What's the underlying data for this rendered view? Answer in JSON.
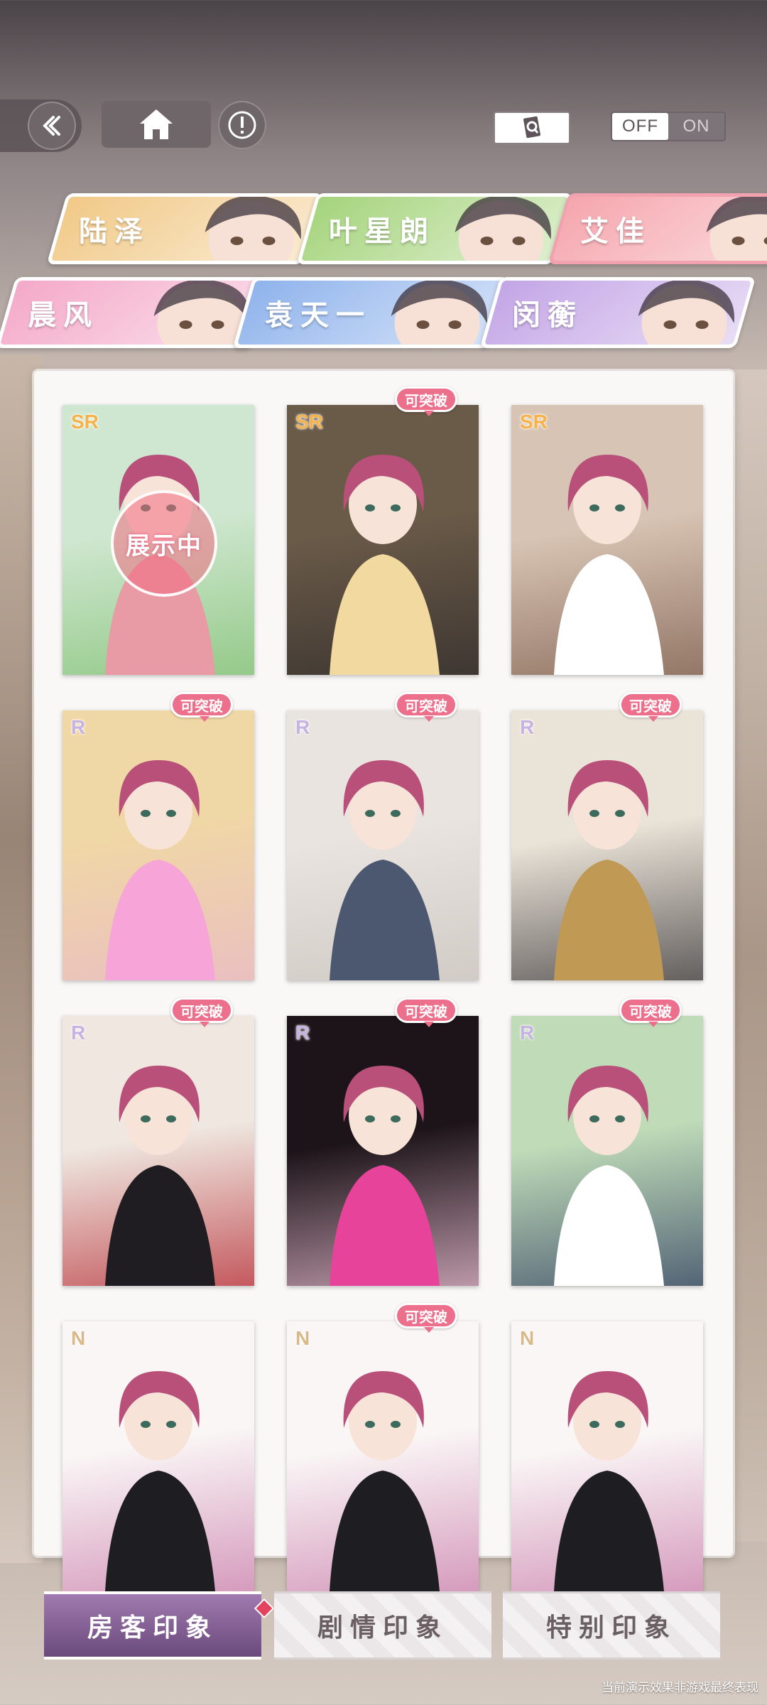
{
  "toolbar": {
    "back_icon": "double-chevron-left-icon",
    "home_icon": "home-icon",
    "info_icon": "exclamation-icon",
    "card_view_icon": "card-search-icon",
    "toggle_off": "OFF",
    "toggle_on": "ON",
    "toggle_state": "OFF"
  },
  "characters": [
    {
      "name": "陆泽",
      "color": "#f1c987"
    },
    {
      "name": "叶星朗",
      "color": "#a5d47c"
    },
    {
      "name": "艾佳",
      "color": "#f5a6ad",
      "active": true
    },
    {
      "name": "晨风",
      "color": "#f4a9c9"
    },
    {
      "name": "袁天一",
      "color": "#8fb3ec"
    },
    {
      "name": "闵蘅",
      "color": "#c3a5e6"
    }
  ],
  "cards": [
    {
      "rarity": "SR",
      "badge": "",
      "stamp": "展示中"
    },
    {
      "rarity": "SR",
      "badge": "可突破",
      "stamp": ""
    },
    {
      "rarity": "SR",
      "badge": "",
      "stamp": ""
    },
    {
      "rarity": "R",
      "badge": "可突破",
      "stamp": ""
    },
    {
      "rarity": "R",
      "badge": "可突破",
      "stamp": ""
    },
    {
      "rarity": "R",
      "badge": "可突破",
      "stamp": ""
    },
    {
      "rarity": "R",
      "badge": "可突破",
      "stamp": ""
    },
    {
      "rarity": "R",
      "badge": "可突破",
      "stamp": ""
    },
    {
      "rarity": "R",
      "badge": "可突破",
      "stamp": ""
    },
    {
      "rarity": "N",
      "badge": "",
      "stamp": ""
    },
    {
      "rarity": "N",
      "badge": "可突破",
      "stamp": ""
    },
    {
      "rarity": "N",
      "badge": "",
      "stamp": ""
    }
  ],
  "bottom_tabs": [
    {
      "label": "房客印象",
      "active": true
    },
    {
      "label": "剧情印象",
      "active": false
    },
    {
      "label": "特别印象",
      "active": false
    }
  ],
  "footnote": "当前演示效果非游戏最终表现"
}
